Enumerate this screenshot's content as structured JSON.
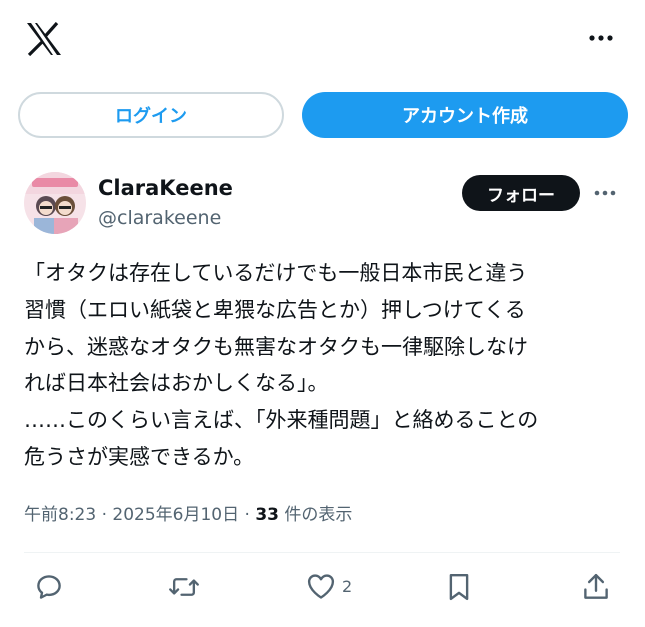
{
  "brand": {
    "logo_icon": "x-logo-icon"
  },
  "auth": {
    "login_label": "ログイン",
    "signup_label": "アカウント作成"
  },
  "post": {
    "display_name": "ClaraKeene",
    "handle": "@clarakeene",
    "follow_label": "フォロー",
    "text": "「オタクは存在しているだけでも一般日本市民と違う\n習慣（エロい紙袋と卑猥な広告とか）押しつけてくる\nから、迷惑なオタクも無害なオタクも一律駆除しなけ\nれば日本社会はおかしくなる」。\n……このくらい言えば、「外来種問題」と絡めることの\n危うさが実感できるか。",
    "time": "午前8:23",
    "date": "2025年6月10日",
    "separator": "·",
    "views_count": "33",
    "views_label": "件の表示",
    "like_count": "2"
  },
  "colors": {
    "accent": "#1d9bf0",
    "text": "#0f1419",
    "muted": "#536471",
    "border": "#cfd9de"
  }
}
